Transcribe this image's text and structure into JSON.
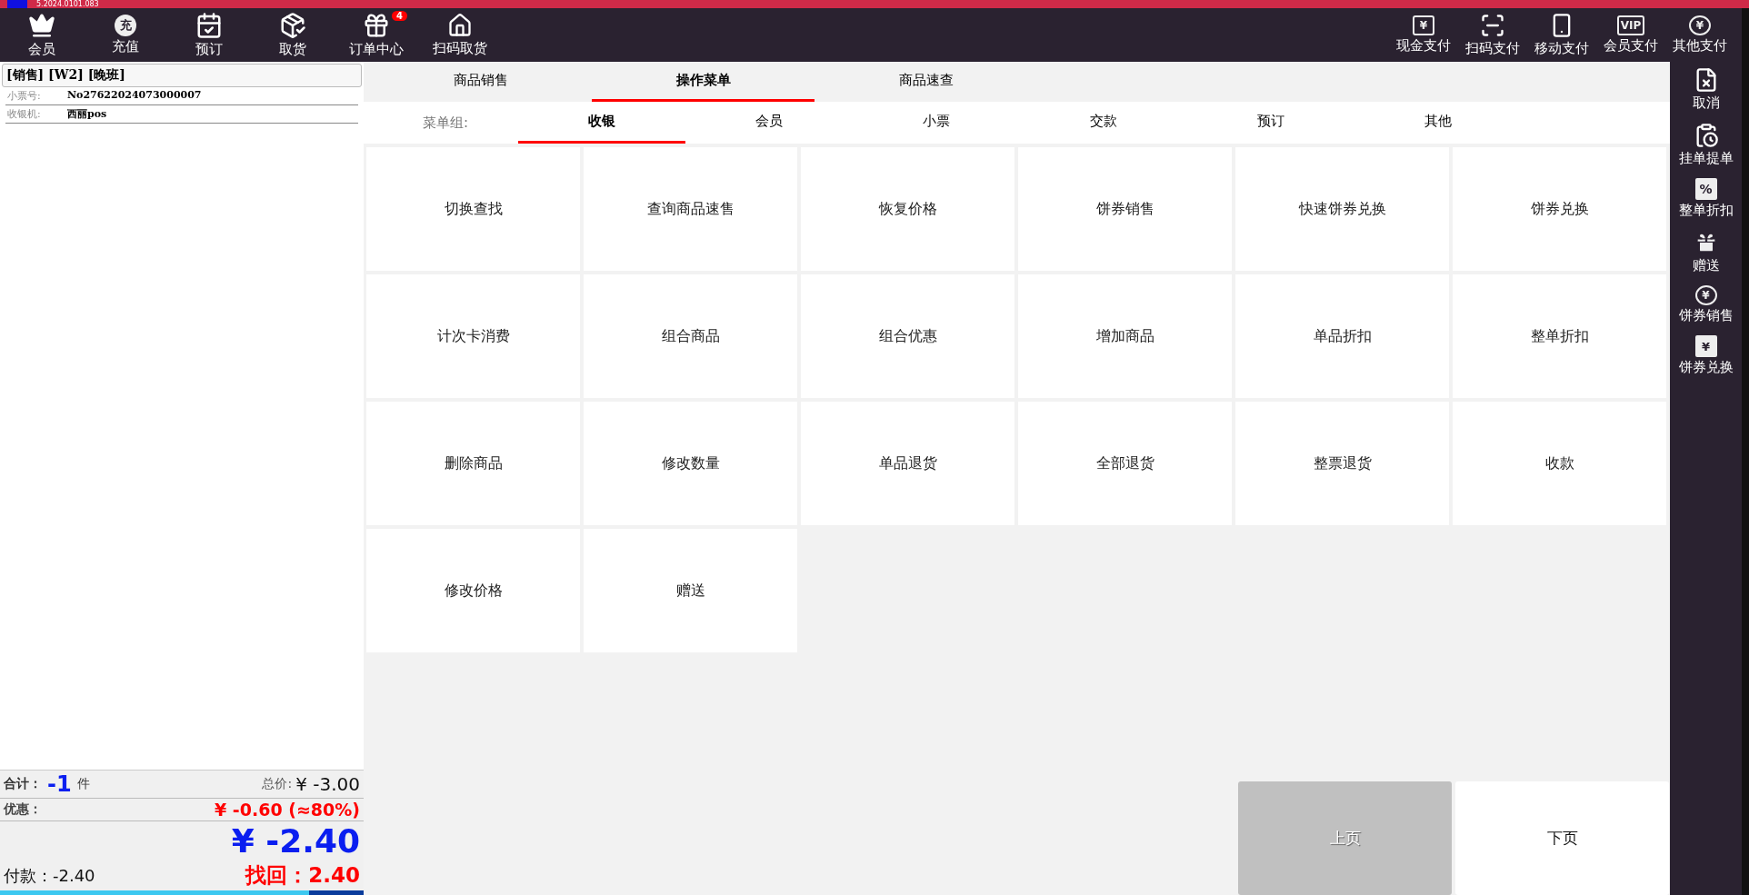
{
  "title_bar": {
    "version": "5.2024.0101.083"
  },
  "toolbar": {
    "left": [
      {
        "label": "会员"
      },
      {
        "label": "充值",
        "glyph": "充"
      },
      {
        "label": "预订"
      },
      {
        "label": "取货"
      },
      {
        "label": "订单中心",
        "badge": "4"
      },
      {
        "label": "扫码取货"
      }
    ],
    "right": [
      {
        "label": "现金支付",
        "glyph": "¥"
      },
      {
        "label": "扫码支付"
      },
      {
        "label": "移动支付"
      },
      {
        "label": "会员支付",
        "glyph": "VIP"
      },
      {
        "label": "其他支付",
        "glyph": "¥"
      }
    ]
  },
  "order": {
    "header": "[销售] [W2] [晚班]",
    "fields": [
      {
        "label": "小票号:",
        "value": "No27622024073000007"
      },
      {
        "label": "收银机:",
        "value": "西丽pos"
      }
    ],
    "count_label": "合计：",
    "count": "-1",
    "count_unit": "件",
    "total_label": "总价:",
    "total": "¥ -3.00",
    "discount_label": "优惠：",
    "discount": "¥ -0.60 (≈80%)",
    "due": "¥ -2.40",
    "paid": "付款：-2.40",
    "change": "找回：2.40"
  },
  "tabs": [
    {
      "label": "商品销售",
      "selected": false
    },
    {
      "label": "操作菜单",
      "selected": true
    },
    {
      "label": "商品速查",
      "selected": false
    }
  ],
  "menu_groups": {
    "label": "菜单组:",
    "items": [
      {
        "label": "收银",
        "selected": true
      },
      {
        "label": "会员",
        "selected": false
      },
      {
        "label": "小票",
        "selected": false
      },
      {
        "label": "交款",
        "selected": false
      },
      {
        "label": "预订",
        "selected": false
      },
      {
        "label": "其他",
        "selected": false
      }
    ]
  },
  "actions": [
    "切换查找",
    "查询商品速售",
    "恢复价格",
    "饼券销售",
    "快速饼券兑换",
    "饼券兑换",
    "计次卡消费",
    "组合商品",
    "组合优惠",
    "增加商品",
    "单品折扣",
    "整单折扣",
    "删除商品",
    "修改数量",
    "单品退货",
    "全部退货",
    "整票退货",
    "收款",
    "修改价格",
    "赠送"
  ],
  "pager": [
    {
      "label": "上页",
      "disabled": true
    },
    {
      "label": "下页",
      "disabled": false
    }
  ],
  "sidebar": [
    {
      "label": "取消"
    },
    {
      "label": "挂单提单"
    },
    {
      "label": "整单折扣",
      "glyph": "%"
    },
    {
      "label": "赠送"
    },
    {
      "label": "饼券销售",
      "glyph": "¥"
    },
    {
      "label": "饼券兑换",
      "glyph": "¥"
    }
  ]
}
